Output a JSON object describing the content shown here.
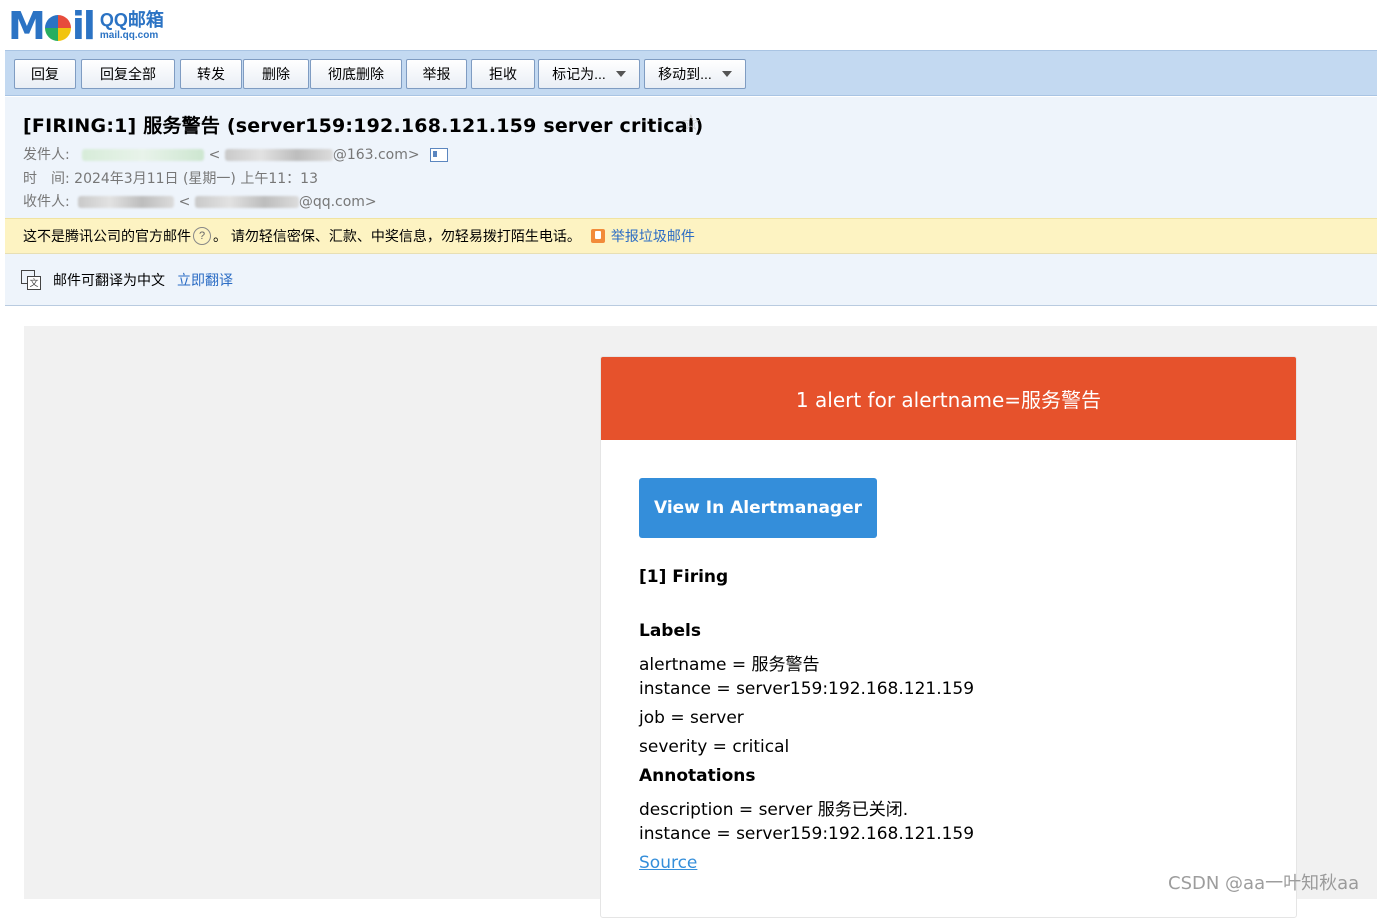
{
  "logo": {
    "mark_left": "M",
    "mark_right": "il",
    "cn": "QQ邮箱",
    "en": "mail.qq.com"
  },
  "toolbar": {
    "reply": "回复",
    "reply_all": "回复全部",
    "forward": "转发",
    "delete": "删除",
    "delete_permanent": "彻底删除",
    "report": "举报",
    "reject": "拒收",
    "mark_as": "标记为...",
    "move_to": "移动到..."
  },
  "email": {
    "subject": "[FIRING:1] 服务警告 (server159:192.168.121.159 server critical)",
    "from_label": "发件人:",
    "from_addr_suffix": "@163.com>",
    "time_label": "时　间:",
    "time_value": "2024年3月11日 (星期一) 上午11：13",
    "to_label": "收件人:",
    "to_addr_suffix": "@qq.com>"
  },
  "warning": {
    "text1": "这不是腾讯公司的官方邮件",
    "text2": "。 请勿轻信密保、汇款、中奖信息，勿轻易拨打陌生电话。",
    "report_link": "举报垃圾邮件"
  },
  "translate": {
    "text": "邮件可翻译为中文",
    "link": "立即翻译"
  },
  "alert": {
    "header": "1 alert for alertname=服务警告",
    "view_button": "View In Alertmanager",
    "firing": "[1] Firing",
    "labels_heading": "Labels",
    "labels": [
      "alertname = 服务警告",
      "instance = server159:192.168.121.159",
      "job = server",
      "severity = critical"
    ],
    "annotations_heading": "Annotations",
    "annotations": [
      "description = server 服务已关闭.",
      "instance = server159:192.168.121.159"
    ],
    "source_link": "Source"
  },
  "watermark": "CSDN @aa一叶知秋aa",
  "colors": {
    "alert_red": "#e6522c",
    "button_blue": "#348eda",
    "toolbar_blue": "#c3d9f1"
  }
}
